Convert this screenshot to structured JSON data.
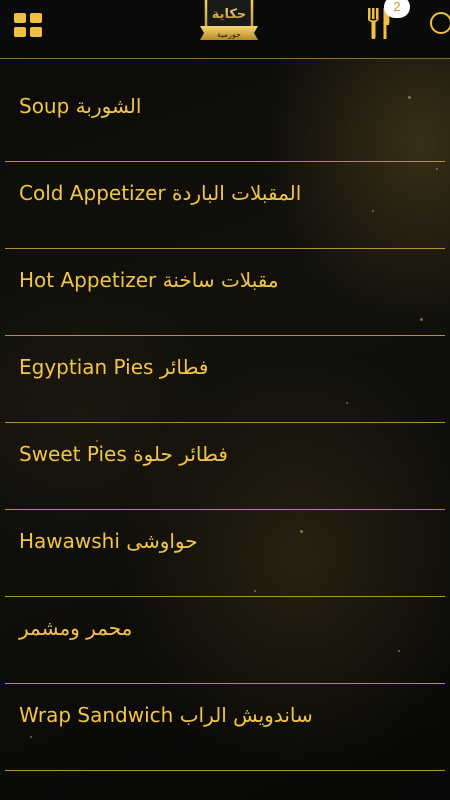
{
  "header": {
    "logo_text": "حكاية",
    "logo_subtext": "جورمية",
    "cart_count": "2",
    "menu_icon": "grid-menu-icon",
    "cart_icon": "fork-knife-icon",
    "search_icon": "search-icon"
  },
  "menu": {
    "items": [
      {
        "label": "Soup الشوربة"
      },
      {
        "label": "Cold Appetizer المقبلات الباردة"
      },
      {
        "label": "Hot Appetizer مقبلات ساخنة"
      },
      {
        "label": "Egyptian Pies فطائر"
      },
      {
        "label": "Sweet Pies فطائر حلوة"
      },
      {
        "label": "Hawawshi حواوشى"
      },
      {
        "label": "محمر ومشمر"
      },
      {
        "label": "Wrap Sandwich ساندويش الراب"
      }
    ]
  },
  "colors": {
    "accent": "#f0c040",
    "divider": "#b5912f",
    "background": "#0a0a08"
  }
}
